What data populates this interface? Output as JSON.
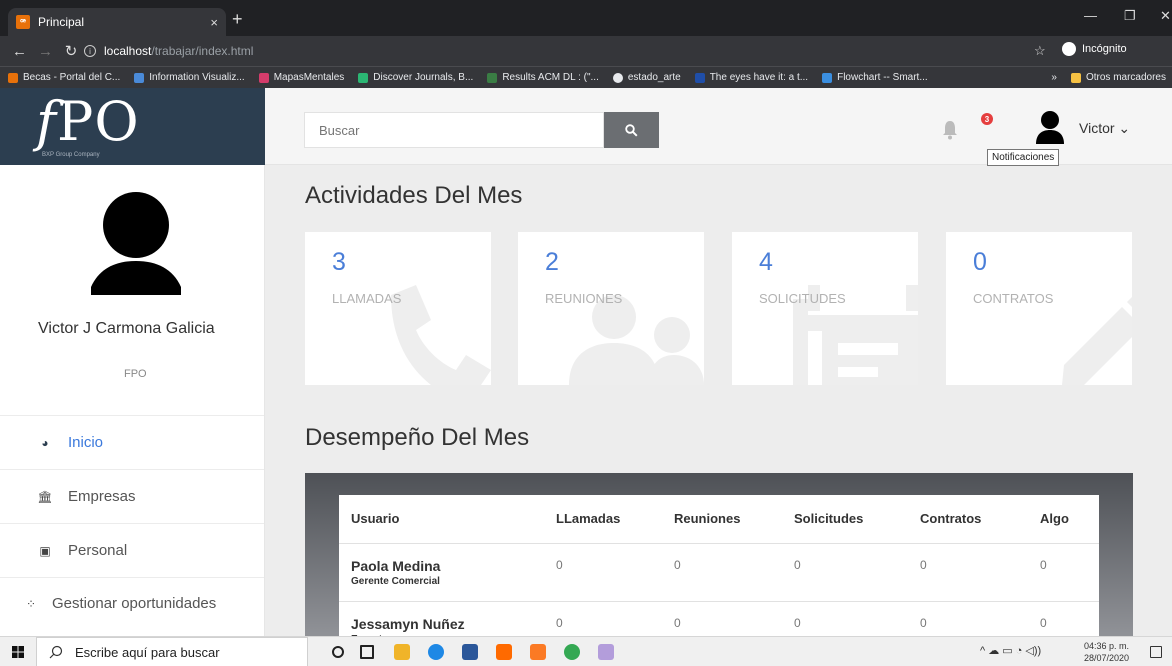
{
  "browser": {
    "tab_title": "Principal",
    "tab_close": "×",
    "new_tab": "+",
    "url_host": "localhost",
    "url_path": "/trabajar/index.html",
    "incognito_label": "Incógnito",
    "bookmarks": [
      {
        "label": "Becas - Portal del C...",
        "color": "#e8710a"
      },
      {
        "label": "Information Visualiz...",
        "color": "#4a8ad8"
      },
      {
        "label": "MapasMentales",
        "color": "#d53c6b"
      },
      {
        "label": "Discover Journals, B...",
        "color": "#2bb673"
      },
      {
        "label": "Results ACM DL : (\"...",
        "color": "#3a7d44"
      },
      {
        "label": "estado_arte",
        "color": "#e8eaed"
      },
      {
        "label": "The eyes have it: a t...",
        "color": "#1f4ea8"
      },
      {
        "label": "Flowchart -- Smart...",
        "color": "#3b8fe0"
      }
    ],
    "bookmarks_more": "»",
    "other_bookmarks": "Otros marcadores"
  },
  "header": {
    "logo_text": "PO",
    "logo_f": "f",
    "logo_subtitle": "BXP Group Company",
    "search_placeholder": "Buscar",
    "notification_count": "3",
    "notification_tooltip": "Notificaciones",
    "user_menu": "Victor ⌄"
  },
  "sidebar": {
    "profile_name": "Victor J Carmona Galicia",
    "profile_org": "FPO",
    "items": [
      {
        "label": "Inicio",
        "icon": "dashboard-icon",
        "active": true
      },
      {
        "label": "Empresas",
        "icon": "institution-icon",
        "active": false
      },
      {
        "label": "Personal",
        "icon": "id-card-icon",
        "active": false
      },
      {
        "label": "Gestionar oportunidades",
        "icon": "spinner-icon",
        "active": false
      }
    ]
  },
  "main": {
    "activities_title": "Actividades Del Mes",
    "performance_title": "Desempeño Del Mes",
    "cards": [
      {
        "count": "3",
        "label": "LLAMADAS",
        "icon": "phone-icon"
      },
      {
        "count": "2",
        "label": "REUNIONES",
        "icon": "users-icon"
      },
      {
        "count": "4",
        "label": "SOLICITUDES",
        "icon": "calendar-icon"
      },
      {
        "count": "0",
        "label": "CONTRATOS",
        "icon": "pencil-icon"
      }
    ],
    "table": {
      "headers": [
        "Usuario",
        "LLamadas",
        "Reuniones",
        "Solicitudes",
        "Contratos",
        "Algo"
      ],
      "rows": [
        {
          "name": "Paola Medina",
          "role": "Gerente Comercial",
          "values": [
            "0",
            "0",
            "0",
            "0",
            "0"
          ]
        },
        {
          "name": "Jessamyn Nuñez",
          "role": "Experto",
          "values": [
            "0",
            "0",
            "0",
            "0",
            "0"
          ]
        }
      ]
    }
  },
  "taskbar": {
    "search_placeholder": "Escribe aquí para buscar",
    "time": "04:36 p. m.",
    "date": "28/07/2020"
  },
  "colors": {
    "accent": "#4a7ed8",
    "logo_bg": "#2c3e50",
    "badge": "#e53e3e"
  }
}
